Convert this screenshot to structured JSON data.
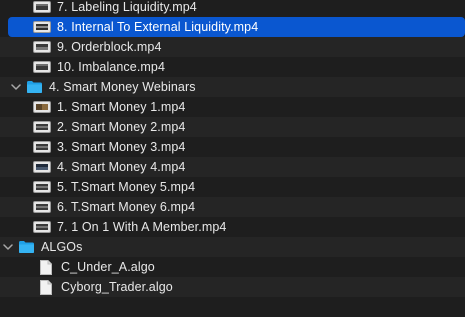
{
  "rows": [
    {
      "label": "7. Labeling Liquidity.mp4",
      "icon": "video-file-icon"
    },
    {
      "label": "8. Internal To External Liquidity.mp4",
      "icon": "video-file-icon",
      "selected": true
    },
    {
      "label": "9. Orderblock.mp4",
      "icon": "video-file-icon"
    },
    {
      "label": "10. Imbalance.mp4",
      "icon": "video-file-icon"
    },
    {
      "label": "4. Smart Money Webinars",
      "icon": "folder-icon",
      "expanded": true
    },
    {
      "label": "1. Smart Money 1.mp4",
      "icon": "video-file-icon"
    },
    {
      "label": "2. Smart Money 2.mp4",
      "icon": "video-file-icon"
    },
    {
      "label": "3. Smart Money 3.mp4",
      "icon": "video-file-icon"
    },
    {
      "label": "4. Smart Money 4.mp4",
      "icon": "video-file-icon"
    },
    {
      "label": "5. T.Smart Money 5.mp4",
      "icon": "video-file-icon"
    },
    {
      "label": "6. T.Smart Money 6.mp4",
      "icon": "video-file-icon"
    },
    {
      "label": "7. 1 On 1 With A Member.mp4",
      "icon": "video-file-icon"
    },
    {
      "label": "ALGOs",
      "icon": "folder-icon",
      "expanded": true
    },
    {
      "label": "C_Under_A.algo",
      "icon": "document-icon"
    },
    {
      "label": "Cyborg_Trader.algo",
      "icon": "document-icon"
    }
  ],
  "colors": {
    "background": "#1e1e1e",
    "alternate_row": "#252525",
    "selection": "#0a57d0",
    "folder": "#1fa0e6"
  }
}
